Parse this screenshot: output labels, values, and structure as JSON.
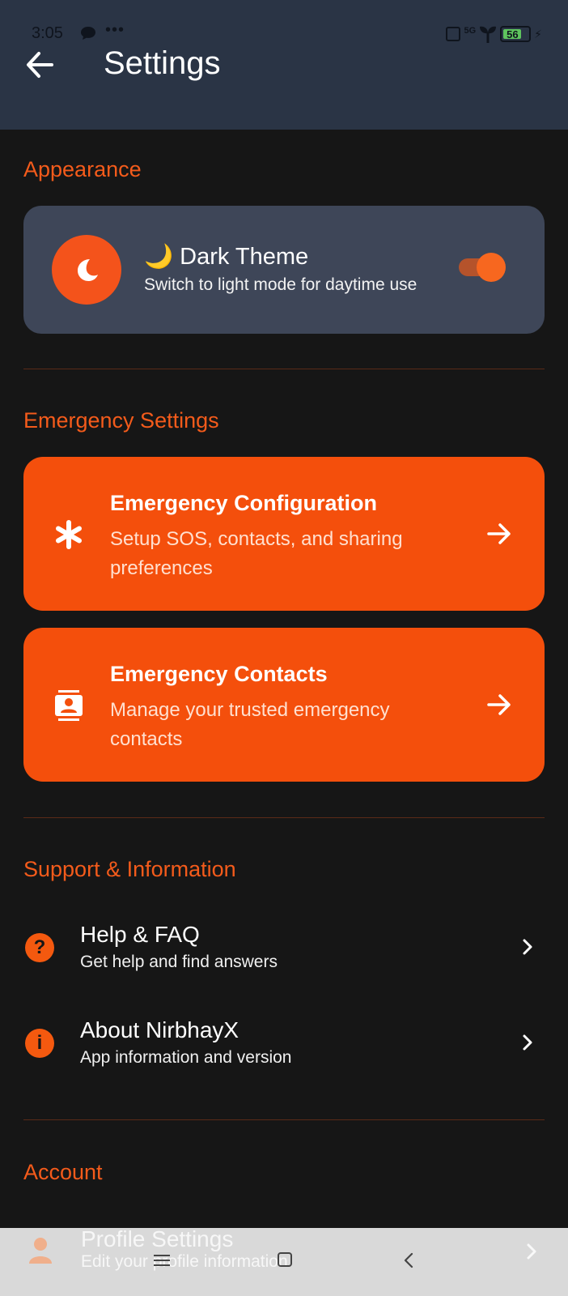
{
  "status_bar": {
    "time": "3:05",
    "dots": "•••",
    "network": "5G",
    "battery": "56"
  },
  "header": {
    "title": "Settings",
    "back_icon": "arrow-left-icon"
  },
  "sections": {
    "appearance": "Appearance",
    "emergency": "Emergency Settings",
    "support": "Support & Information",
    "account": "Account"
  },
  "theme_card": {
    "title": "🌙 Dark Theme",
    "subtitle": "Switch to light mode for daytime use",
    "toggle_on": true,
    "icon": "moon-icon"
  },
  "emergency_cards": [
    {
      "title": "Emergency Configuration",
      "subtitle": "Setup SOS, contacts, and sharing preferences",
      "icon": "asterisk-icon"
    },
    {
      "title": "Emergency Contacts",
      "subtitle": "Manage your trusted emergency contacts",
      "icon": "contacts-icon"
    }
  ],
  "support_items": [
    {
      "title": "Help & FAQ",
      "subtitle": "Get help and find answers",
      "icon": "question-icon"
    },
    {
      "title": "About NirbhayX",
      "subtitle": "App information and version",
      "icon": "info-icon"
    }
  ],
  "account_items": [
    {
      "title": "Profile Settings",
      "subtitle": "Edit your profile information",
      "icon": "person-icon"
    }
  ],
  "colors": {
    "accent": "#f45b1b",
    "card_orange": "#f44f0c",
    "header_bg": "#2a3445",
    "theme_card_bg": "#3e4658",
    "page_bg": "#161616"
  }
}
